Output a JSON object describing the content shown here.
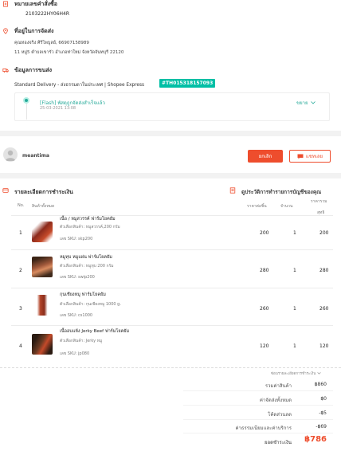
{
  "order": {
    "number_label": "หมายเลขคำสั่งซื้อ",
    "number": "2103222HY06H4R"
  },
  "address": {
    "title": "ที่อยู่ในการจัดส่ง",
    "line1": "คุณทองจริง ศิริไพบูลย์, 66907158989",
    "line2": "11 หมู่5 ตำบลเขารัว อำเภอท่าใหม่ จังหวัดจันทบุรี 22120"
  },
  "shipping": {
    "title": "ข้อมูลการขนส่ง",
    "method": "Standard Delivery - ส่งธรรมดาในประเทศ | Shopee Express",
    "tracking": "#TH015318157093",
    "event_status": "[Flash] พัสดุถูกจัดส่งสำเร็จแล้ว",
    "event_time": "25-03-2021 13:08",
    "expand_label": "ขยาย"
  },
  "buyer": {
    "name": "meantima",
    "cancel_label": "ยกเลิก",
    "chat_label": "แชทเลย"
  },
  "payment": {
    "title": "รายละเอียดการชำระเงิน",
    "transactions_label": "ดูประวัติการทำรายการบัญชีของคุณ",
    "headers": {
      "no": "No.",
      "product": "สินค้าทั้งหมด",
      "unit_price": "ราคาต่อชิ้น",
      "qty": "จำนวน",
      "subtotal_top": "ราคารวม",
      "subtotal_bottom": "สุทธิ"
    },
    "items": [
      {
        "no": "1",
        "name": "เนื้อ / หมูสวรรค์ ฟาร์มโยคยัม",
        "variant": "ตัวเลือกสินค้า: หมูสวรรค์,200 กรัม",
        "sku": "เลข SKU: skp200",
        "price": "200",
        "qty": "1",
        "total": "200"
      },
      {
        "no": "2",
        "name": "หมูทุบ หมูแผ่น ฟาร์มโยคยัม",
        "variant": "ตัวเลือกสินค้า: หมูทุบ 200 กรัม",
        "sku": "เลข SKU: swip200",
        "price": "280",
        "qty": "1",
        "total": "280"
      },
      {
        "no": "3",
        "name": "กุนเชียงหมู ฟาร์มโยคยัม",
        "variant": "ตัวเลือกสินค้า: กุนเชียงหมู 1000 g.",
        "sku": "เลข SKU: cs1000",
        "price": "260",
        "qty": "1",
        "total": "260"
      },
      {
        "no": "4",
        "name": "เนื้ออบแห้ง Jerky Beef ฟาร์มโยคยัม",
        "variant": "ตัวเลือกสินค้า: Jerky หมู",
        "sku": "เลข SKU: jp080",
        "price": "120",
        "qty": "1",
        "total": "120"
      }
    ],
    "summary_toggle": "ซ่อนรายละเอียดการชำระเงิน",
    "summary": [
      {
        "label": "รวมค่าสินค้า",
        "value": "฿860"
      },
      {
        "label": "ค่าจัดส่งทั้งหมด",
        "value": "฿0"
      },
      {
        "label": "โค้ดส่วนลด",
        "value": "-฿5"
      },
      {
        "label": "ค่าธรรมเนียมและค่าบริการ",
        "value": "-฿69"
      }
    ],
    "net_label": "ยอดชำระเงิน",
    "net_value": "฿786"
  },
  "colors": {
    "accent": "#ee4d2d",
    "teal": "#00bfa5"
  }
}
